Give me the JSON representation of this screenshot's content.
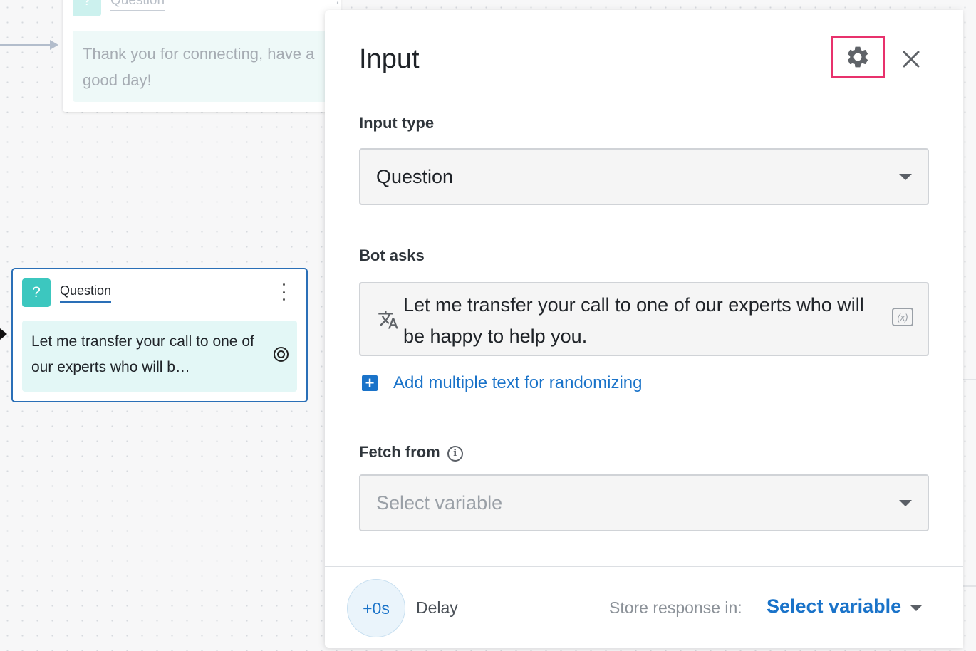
{
  "canvas": {
    "top_node": {
      "badge": "?",
      "type_label": "Question",
      "message": "Thank you for connecting, have a good day!"
    },
    "main_node": {
      "badge": "?",
      "type_label": "Question",
      "message": "Let me transfer your call to one of our experts who will b…"
    }
  },
  "panel": {
    "title": "Input",
    "input_type": {
      "label": "Input type",
      "value": "Question"
    },
    "bot_asks": {
      "label": "Bot asks",
      "text": "Let me transfer your call to one of our experts who will be happy to help you.",
      "variable_icon": "(x)"
    },
    "add_multiple": {
      "icon": "+",
      "label": "Add multiple text for randomizing"
    },
    "fetch_from": {
      "label": "Fetch from",
      "info_icon": "i",
      "placeholder": "Select variable"
    },
    "footer": {
      "delay_value": "+0s",
      "delay_label": "Delay",
      "store_label": "Store response in:",
      "store_value": "Select variable"
    }
  },
  "colors": {
    "accent": "#1a73c9",
    "highlight": "#e8316c",
    "node_badge": "#3cc7bf",
    "node_border": "#2a6fb7"
  }
}
